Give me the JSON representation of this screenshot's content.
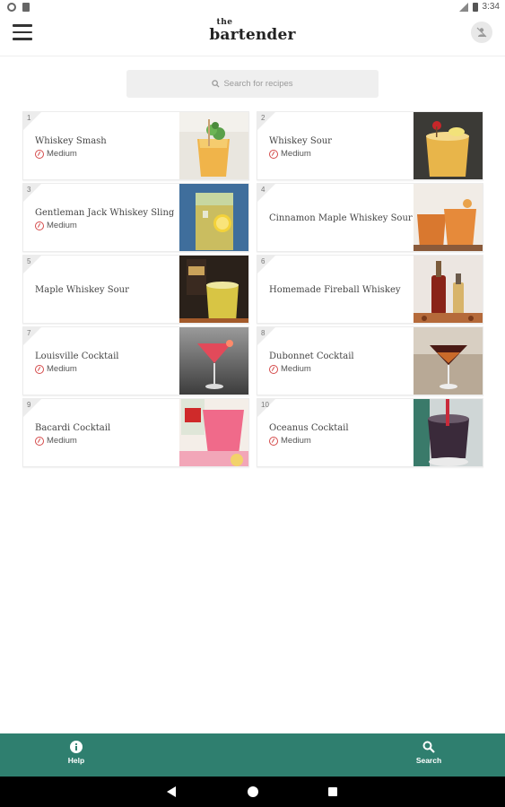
{
  "status_bar": {
    "time": "3:34",
    "icons": [
      "settings-dot-icon",
      "sd-card-icon",
      "signal-icon",
      "battery-icon"
    ]
  },
  "header": {
    "logo_small": "the",
    "logo_main": "bartender",
    "menu_icon": "hamburger-menu-icon",
    "profile_icon": "profile-icon"
  },
  "search": {
    "placeholder": "Search for recipes",
    "icon": "search-icon"
  },
  "recipes": [
    {
      "number": "1",
      "title": "Whiskey Smash",
      "difficulty": "Medium",
      "image": "whiskey-smash-photo"
    },
    {
      "number": "2",
      "title": "Whiskey Sour",
      "difficulty": "Medium",
      "image": "whiskey-sour-photo"
    },
    {
      "number": "3",
      "title": "Gentleman Jack Whiskey Sling",
      "difficulty": "Medium",
      "image": "gentleman-jack-sling-photo"
    },
    {
      "number": "4",
      "title": "Cinnamon Maple Whiskey Sour",
      "difficulty": "",
      "image": "cinnamon-maple-sour-photo"
    },
    {
      "number": "5",
      "title": "Maple Whiskey Sour",
      "difficulty": "",
      "image": "maple-whiskey-sour-photo"
    },
    {
      "number": "6",
      "title": "Homemade Fireball Whiskey",
      "difficulty": "",
      "image": "homemade-fireball-photo"
    },
    {
      "number": "7",
      "title": "Louisville Cocktail",
      "difficulty": "Medium",
      "image": "louisville-cocktail-photo"
    },
    {
      "number": "8",
      "title": "Dubonnet Cocktail",
      "difficulty": "Medium",
      "image": "dubonnet-cocktail-photo"
    },
    {
      "number": "9",
      "title": "Bacardi Cocktail",
      "difficulty": "Medium",
      "image": "bacardi-cocktail-photo"
    },
    {
      "number": "10",
      "title": "Oceanus Cocktail",
      "difficulty": "Medium",
      "image": "oceanus-cocktail-photo"
    }
  ],
  "bottom_nav": {
    "help_label": "Help",
    "search_label": "Search"
  },
  "colors": {
    "bottom_nav_bg": "#2f7f6f",
    "difficulty_icon": "#d44a4a"
  }
}
